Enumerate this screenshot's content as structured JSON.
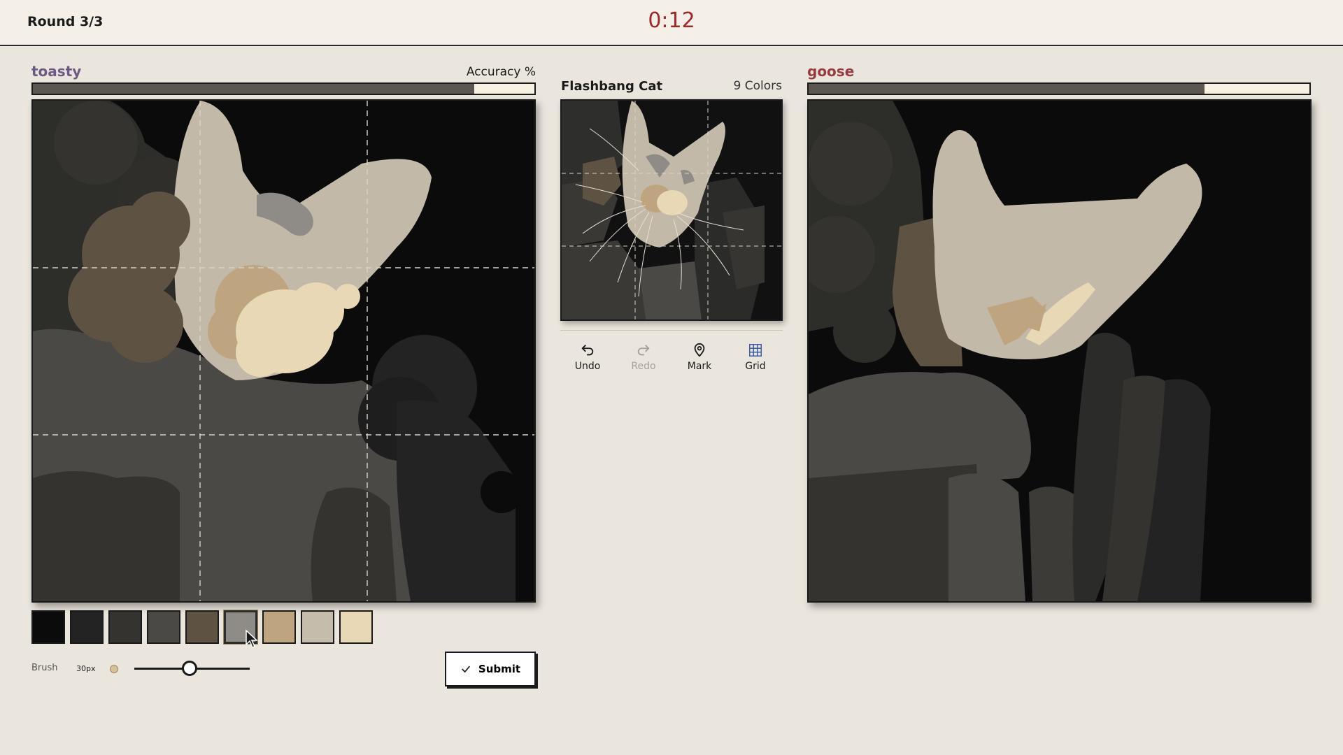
{
  "header": {
    "round": "Round 3/3",
    "timer": "0:12"
  },
  "colors": {
    "timer": "#a2272b",
    "player1": "#6b5a84",
    "player2": "#9a3b3f"
  },
  "player1": {
    "name": "toasty",
    "accuracy_label": "Accuracy %",
    "accuracy": 0.88
  },
  "player2": {
    "name": "goose",
    "accuracy": 0.79
  },
  "reference": {
    "title": "Flashbang Cat",
    "colors": "9 Colors"
  },
  "tools": [
    {
      "label": "Undo",
      "icon": "undo-icon",
      "enabled": true
    },
    {
      "label": "Redo",
      "icon": "redo-icon",
      "enabled": false
    },
    {
      "label": "Mark",
      "icon": "map-pin-icon",
      "enabled": true
    },
    {
      "label": "Grid",
      "icon": "grid-icon",
      "enabled": true
    }
  ],
  "palette": [
    "#0b0b0b",
    "#232323",
    "#34332f",
    "#4b4946",
    "#5e5243",
    "#8f8b86",
    "#bea580",
    "#c6bcac",
    "#e8d8b6"
  ],
  "selected_swatch": 5,
  "brush": {
    "label": "Brush",
    "size": "30px",
    "level": 0.48
  },
  "submit_label": "Submit"
}
